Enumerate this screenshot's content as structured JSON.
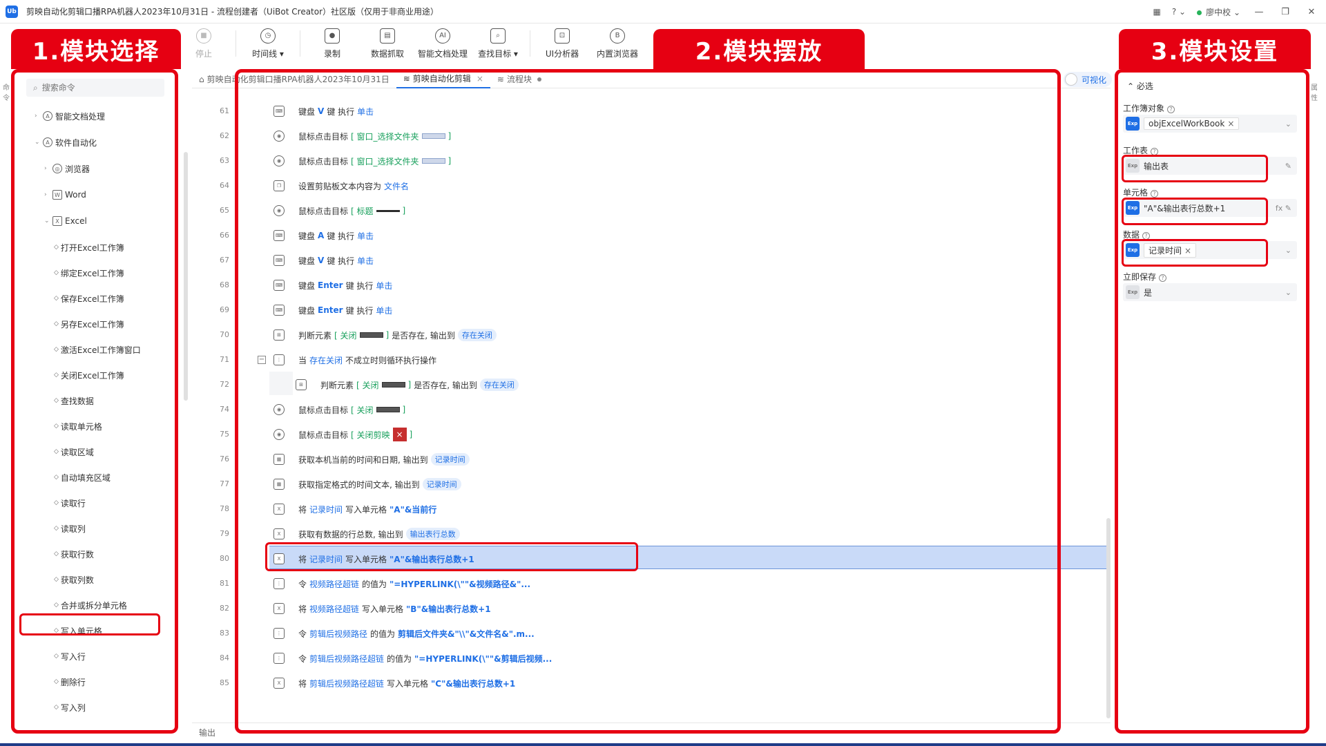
{
  "title": {
    "app_logo": "Ub",
    "text": "剪映自动化剪辑口播RPA机器人2023年10月31日 - 流程创建者（UiBot Creator）社区版（仅用于非商业用途）",
    "user": "廖中校",
    "status_color": "#27b35a"
  },
  "toolbar": [
    {
      "label": "停止",
      "icon": "stop-icon",
      "disabled": true
    },
    {
      "label": "时间线 ▾",
      "icon": "clock-icon"
    },
    {
      "label": "录制",
      "icon": "record-icon"
    },
    {
      "label": "数据抓取",
      "icon": "data-scrape-icon"
    },
    {
      "label": "智能文档处理",
      "icon": "ai-doc-icon"
    },
    {
      "label": "查找目标 ▾",
      "icon": "find-target-icon"
    },
    {
      "label": "UI分析器",
      "icon": "ui-analyzer-icon"
    },
    {
      "label": "内置浏览器",
      "icon": "browser-icon"
    }
  ],
  "banners": {
    "left": "1.模块选择",
    "middle": "2.模块摆放",
    "right": "3.模块设置"
  },
  "left_panel": {
    "search_placeholder": "搜索命令",
    "edge_tab": "命令",
    "tree": [
      {
        "label": "智能文档处理",
        "arrow": "›",
        "icon": "A"
      },
      {
        "label": "软件自动化",
        "arrow": "⌄",
        "icon": "A"
      },
      {
        "label": "浏览器",
        "arrow": "›",
        "icon": "◎"
      },
      {
        "label": "Word",
        "arrow": "›",
        "icon": "W"
      },
      {
        "label": "Excel",
        "arrow": "⌄",
        "icon": "X"
      },
      {
        "label": "打开Excel工作簿"
      },
      {
        "label": "绑定Excel工作簿"
      },
      {
        "label": "保存Excel工作簿"
      },
      {
        "label": "另存Excel工作簿"
      },
      {
        "label": "激活Excel工作簿窗口"
      },
      {
        "label": "关闭Excel工作簿"
      },
      {
        "label": "查找数据"
      },
      {
        "label": "读取单元格"
      },
      {
        "label": "读取区域"
      },
      {
        "label": "自动填充区域"
      },
      {
        "label": "读取行"
      },
      {
        "label": "读取列"
      },
      {
        "label": "获取行数"
      },
      {
        "label": "获取列数"
      },
      {
        "label": "合并或拆分单元格"
      },
      {
        "label": "写入单元格"
      },
      {
        "label": "写入行"
      },
      {
        "label": "删除行"
      },
      {
        "label": "写入列"
      },
      {
        "label": "删除列"
      }
    ]
  },
  "tabs": [
    {
      "label": "剪映自动化剪辑口播RPA机器人2023年10月31日",
      "icon": "⌂"
    },
    {
      "label": "剪映自动化剪辑",
      "icon": "≋",
      "close": "×",
      "active": true
    },
    {
      "label": "流程块",
      "icon": "≋"
    }
  ],
  "visual_toggle": "可视化",
  "editor": {
    "rows": [
      {
        "num": "61",
        "icon": "kbd",
        "parts": [
          [
            "t",
            "键盘 "
          ],
          [
            "kwb",
            "V"
          ],
          [
            "t",
            " 键 执行 "
          ],
          [
            "kw",
            "单击"
          ]
        ]
      },
      {
        "num": "62",
        "icon": "mouse",
        "parts": [
          [
            "t",
            "鼠标点击目标 "
          ],
          [
            "kwg",
            "[ 窗口_选择文件夹 "
          ],
          [
            "thumb-light",
            ""
          ],
          [
            "kwg",
            " ]"
          ]
        ]
      },
      {
        "num": "63",
        "icon": "mouse",
        "parts": [
          [
            "t",
            "鼠标点击目标 "
          ],
          [
            "kwg",
            "[ 窗口_选择文件夹 "
          ],
          [
            "thumb-light",
            ""
          ],
          [
            "kwg",
            " ]"
          ]
        ]
      },
      {
        "num": "64",
        "icon": "clip",
        "parts": [
          [
            "t",
            "设置剪贴板文本内容为 "
          ],
          [
            "kw",
            "文件名"
          ]
        ]
      },
      {
        "num": "65",
        "icon": "mouse",
        "parts": [
          [
            "t",
            "鼠标点击目标 "
          ],
          [
            "kwg",
            "[ 标题 "
          ],
          [
            "thumb-line",
            ""
          ],
          [
            "kwg",
            " ]"
          ]
        ]
      },
      {
        "num": "66",
        "icon": "kbd",
        "parts": [
          [
            "t",
            "键盘 "
          ],
          [
            "kwb",
            "A"
          ],
          [
            "t",
            " 键 执行 "
          ],
          [
            "kw",
            "单击"
          ]
        ]
      },
      {
        "num": "67",
        "icon": "kbd",
        "parts": [
          [
            "t",
            "键盘 "
          ],
          [
            "kwb",
            "V"
          ],
          [
            "t",
            " 键 执行 "
          ],
          [
            "kw",
            "单击"
          ]
        ]
      },
      {
        "num": "68",
        "icon": "kbd",
        "parts": [
          [
            "t",
            "键盘 "
          ],
          [
            "kwb",
            "Enter"
          ],
          [
            "t",
            " 键 执行 "
          ],
          [
            "kw",
            "单击"
          ]
        ]
      },
      {
        "num": "69",
        "icon": "kbd",
        "parts": [
          [
            "t",
            "键盘 "
          ],
          [
            "kwb",
            "Enter"
          ],
          [
            "t",
            " 键 执行 "
          ],
          [
            "kw",
            "单击"
          ]
        ]
      },
      {
        "num": "70",
        "icon": "judge",
        "parts": [
          [
            "t",
            "判断元素 "
          ],
          [
            "kwg",
            "[ 关闭 "
          ],
          [
            "thumb",
            ""
          ],
          [
            "kwg",
            " ]"
          ],
          [
            "t",
            " 是否存在, 输出到 "
          ],
          [
            "var",
            "存在关闭"
          ]
        ]
      },
      {
        "num": "71",
        "icon": "loop",
        "collapse": "−",
        "parts": [
          [
            "t",
            "当 "
          ],
          [
            "kw",
            "存在关闭"
          ],
          [
            "t",
            " 不成立时则循环执行操作"
          ]
        ]
      },
      {
        "num": "72",
        "icon": "judge",
        "indent": true,
        "parts": [
          [
            "t",
            "判断元素 "
          ],
          [
            "kwg",
            "[ 关闭 "
          ],
          [
            "thumb",
            ""
          ],
          [
            "kwg",
            " ]"
          ],
          [
            "t",
            " 是否存在, 输出到 "
          ],
          [
            "var",
            "存在关闭"
          ]
        ]
      },
      {
        "num": "74",
        "icon": "mouse",
        "parts": [
          [
            "t",
            "鼠标点击目标 "
          ],
          [
            "kwg",
            "[ 关闭 "
          ],
          [
            "thumb",
            ""
          ],
          [
            "kwg",
            " ]"
          ]
        ]
      },
      {
        "num": "75",
        "icon": "mouse",
        "parts": [
          [
            "t",
            "鼠标点击目标 "
          ],
          [
            "kwg",
            "[ 关闭剪映 "
          ],
          [
            "thumb-red",
            "×"
          ],
          [
            "kwg",
            " ]"
          ]
        ]
      },
      {
        "num": "76",
        "icon": "time",
        "parts": [
          [
            "t",
            "获取本机当前的时间和日期, 输出到 "
          ],
          [
            "var",
            "记录时间"
          ]
        ]
      },
      {
        "num": "77",
        "icon": "time",
        "parts": [
          [
            "t",
            "获取指定格式的时间文本, 输出到 "
          ],
          [
            "var",
            "记录时间"
          ]
        ]
      },
      {
        "num": "78",
        "icon": "xls",
        "parts": [
          [
            "t",
            "将 "
          ],
          [
            "kw",
            "记录时间"
          ],
          [
            "t",
            " 写入单元格 "
          ],
          [
            "kwb",
            "\"A\"&当前行"
          ]
        ]
      },
      {
        "num": "79",
        "icon": "xls",
        "parts": [
          [
            "t",
            "获取有数据的行总数, 输出到 "
          ],
          [
            "var",
            "输出表行总数"
          ]
        ]
      },
      {
        "num": "80",
        "icon": "xls",
        "selected": true,
        "parts": [
          [
            "t",
            "将 "
          ],
          [
            "kw",
            "记录时间"
          ],
          [
            "t",
            " 写入单元格 "
          ],
          [
            "kwb",
            "\"A\"&输出表行总数+1"
          ]
        ]
      },
      {
        "num": "81",
        "icon": "loop",
        "parts": [
          [
            "t",
            "令 "
          ],
          [
            "kw",
            "视频路径超链"
          ],
          [
            "t",
            " 的值为 "
          ],
          [
            "kwb",
            "\"=HYPERLINK(\\\"\"&视频路径&\"..."
          ]
        ]
      },
      {
        "num": "82",
        "icon": "xls",
        "parts": [
          [
            "t",
            "将 "
          ],
          [
            "kw",
            "视频路径超链"
          ],
          [
            "t",
            " 写入单元格 "
          ],
          [
            "kwb",
            "\"B\"&输出表行总数+1"
          ]
        ]
      },
      {
        "num": "83",
        "icon": "loop",
        "parts": [
          [
            "t",
            "令 "
          ],
          [
            "kw",
            "剪辑后视频路径"
          ],
          [
            "t",
            " 的值为 "
          ],
          [
            "kwb",
            "剪辑后文件夹&\"\\\\\"&文件名&\".m..."
          ]
        ]
      },
      {
        "num": "84",
        "icon": "loop",
        "parts": [
          [
            "t",
            "令 "
          ],
          [
            "kw",
            "剪辑后视频路径超链"
          ],
          [
            "t",
            " 的值为 "
          ],
          [
            "kwb",
            "\"=HYPERLINK(\\\"\"&剪辑后视频..."
          ]
        ]
      },
      {
        "num": "85",
        "icon": "xls",
        "parts": [
          [
            "t",
            "将 "
          ],
          [
            "kw",
            "剪辑后视频路径超链"
          ],
          [
            "t",
            " 写入单元格 "
          ],
          [
            "kwb",
            "\"C\"&输出表行总数+1"
          ]
        ]
      }
    ],
    "play": "▶",
    "output_label": "输出"
  },
  "right_panel": {
    "section": "⌃ 必选",
    "edge_tab": "属性",
    "fields": [
      {
        "label": "工作簿对象",
        "badge": "Exp",
        "chip": "objExcelWorkBook",
        "chip_close": "×",
        "right": "⌄",
        "badge_grey": false
      },
      {
        "label": "工作表",
        "badge": "Exp",
        "value": "输出表",
        "right": "✎",
        "badge_grey": true
      },
      {
        "label": "单元格",
        "badge": "Exp",
        "value": "\"A\"&输出表行总数+1",
        "right": "fx ✎",
        "badge_grey": false
      },
      {
        "label": "数据",
        "badge": "Exp",
        "chip": "记录时间",
        "chip_close": "×",
        "right": "⌄",
        "badge_grey": false
      },
      {
        "label": "立即保存",
        "badge": "Exp",
        "value": "是",
        "right": "⌄",
        "badge_grey": true
      }
    ]
  },
  "colors": {
    "accent": "#1f6fe5",
    "annotation_red": "#e60012",
    "selected_row": "#c9daf8"
  }
}
